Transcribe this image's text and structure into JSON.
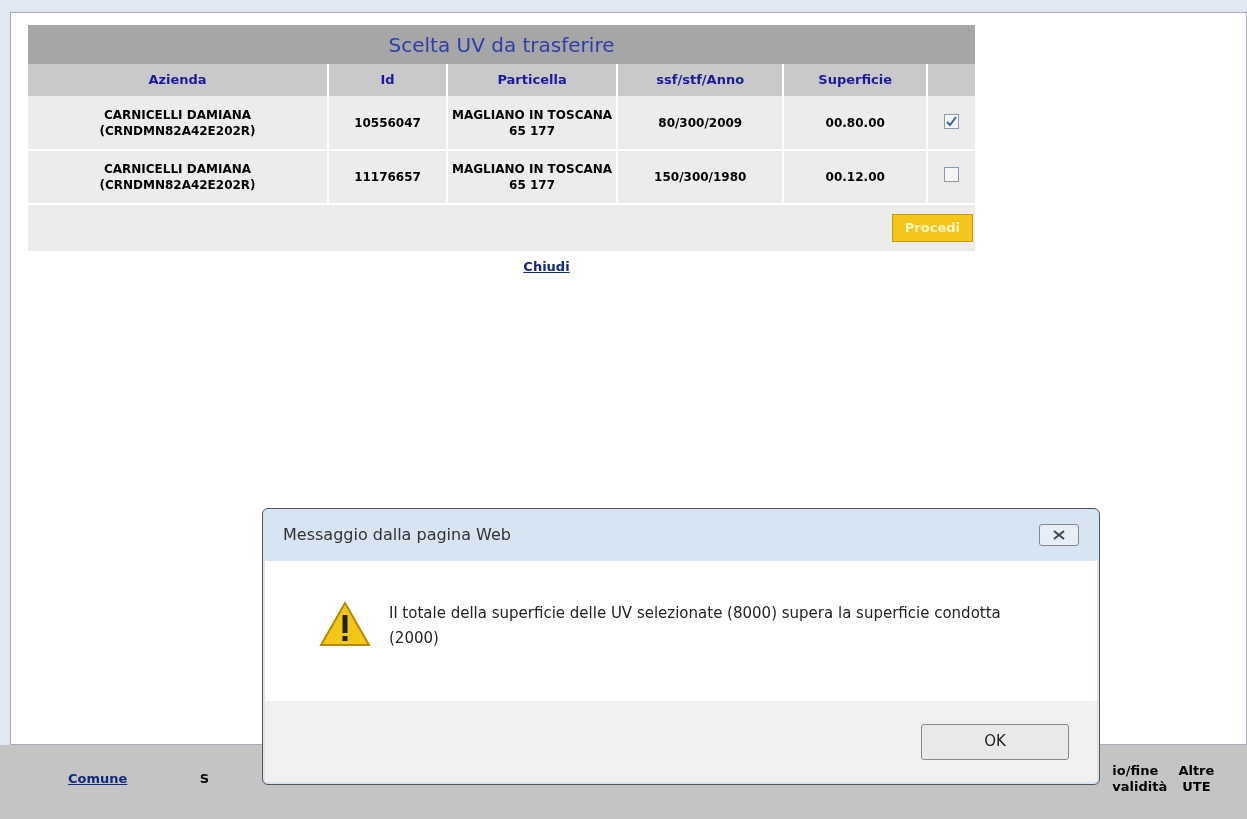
{
  "popup": {
    "title": "Scelta UV da trasferire",
    "columns": [
      "Azienda",
      "Id",
      "Particella",
      "ssf/stf/Anno",
      "Superficie"
    ],
    "rows": [
      {
        "azienda": "CARNICELLI DAMIANA (CRNDMN82A42E202R)",
        "id": "10556047",
        "particella": "MAGLIANO IN TOSCANA 65 177",
        "anno": "80/300/2009",
        "superficie": "00.80.00",
        "checked": true
      },
      {
        "azienda": "CARNICELLI DAMIANA (CRNDMN82A42E202R)",
        "id": "11176657",
        "particella": "MAGLIANO IN TOSCANA 65 177",
        "anno": "150/300/1980",
        "superficie": "00.12.00",
        "checked": false
      }
    ],
    "proceed_button": "Procedi",
    "close_link": "Chiudi"
  },
  "background_table": {
    "columns": [
      {
        "kind": "link",
        "label": "Comune"
      },
      {
        "kind": "text",
        "label": "S"
      },
      {
        "kind": "cut",
        "label": "io/fine validità"
      },
      {
        "kind": "text",
        "label": "Altre UTE"
      }
    ]
  },
  "dialog": {
    "title": "Messaggio dalla pagina Web",
    "message": "Il totale della superficie delle UV selezionate (8000) supera la superficie condotta (2000)",
    "ok_button": "OK"
  }
}
